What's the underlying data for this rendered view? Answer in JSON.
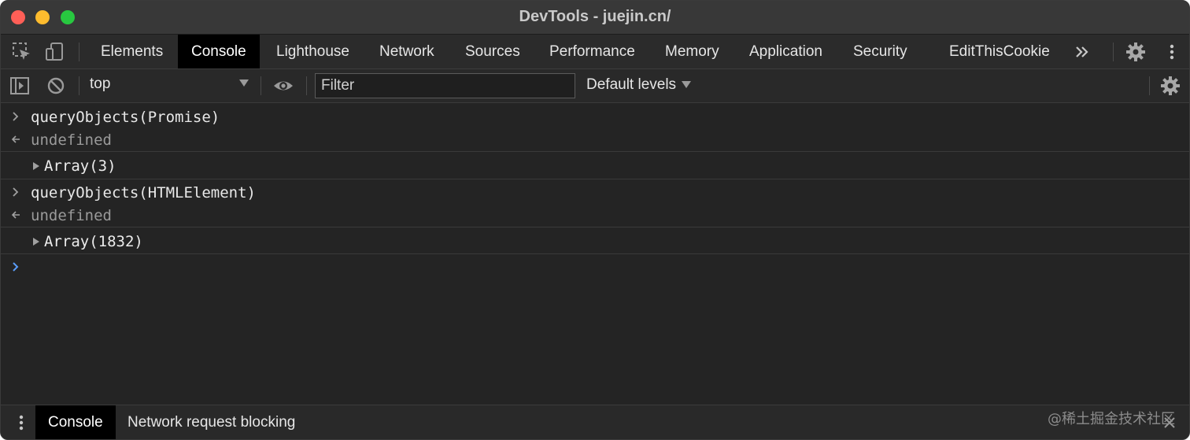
{
  "window": {
    "title": "DevTools - juejin.cn/"
  },
  "tabs": [
    {
      "label": "Elements",
      "active": false
    },
    {
      "label": "Console",
      "active": true
    },
    {
      "label": "Lighthouse",
      "active": false
    },
    {
      "label": "Network",
      "active": false
    },
    {
      "label": "Sources",
      "active": false
    },
    {
      "label": "Performance",
      "active": false
    },
    {
      "label": "Memory",
      "active": false
    },
    {
      "label": "Application",
      "active": false
    },
    {
      "label": "Security",
      "active": false
    },
    {
      "label": "EditThisCookie",
      "active": false
    }
  ],
  "tabbar_icons": {
    "inspect": "inspect-element-icon",
    "device": "device-toolbar-icon",
    "more_tabs": "chevron-double-right-icon",
    "settings": "gear-icon",
    "menu": "kebab-menu-icon"
  },
  "toolbar": {
    "context": "top",
    "filter_placeholder": "Filter",
    "levels": "Default levels"
  },
  "console": {
    "entries": [
      {
        "kind": "input",
        "text": "queryObjects(Promise)"
      },
      {
        "kind": "return",
        "text": "undefined"
      },
      {
        "kind": "object",
        "text": "Array(3)"
      },
      {
        "kind": "input",
        "text": "queryObjects(HTMLElement)"
      },
      {
        "kind": "return",
        "text": "undefined"
      },
      {
        "kind": "object",
        "text": "Array(1832)"
      }
    ]
  },
  "drawer": {
    "tabs": [
      {
        "label": "Console",
        "active": true
      },
      {
        "label": "Network request blocking",
        "active": false
      }
    ],
    "watermark": "@稀土掘金技术社区"
  },
  "colors": {
    "background": "#242424",
    "tab_active": "#000000",
    "prompt_blue": "#5a9cf8"
  }
}
